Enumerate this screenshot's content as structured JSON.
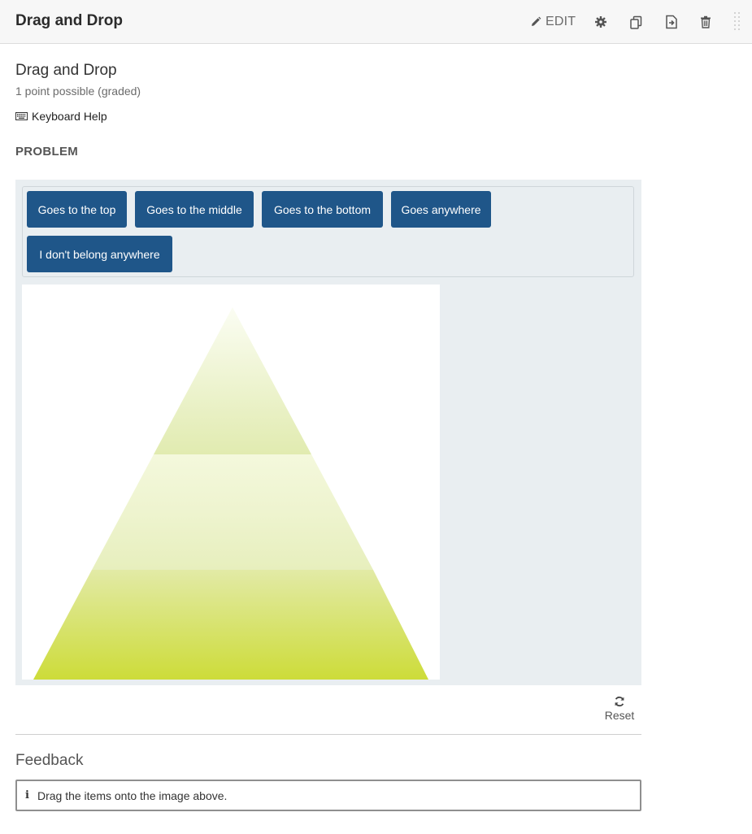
{
  "header": {
    "title": "Drag and Drop",
    "actions": {
      "edit_label": "EDIT",
      "edit_icon": "pencil-icon",
      "settings_icon": "gear-icon",
      "duplicate_icon": "duplicate-icon",
      "move_icon": "move-icon",
      "delete_icon": "trash-icon",
      "drag_icon": "drag-handle-icon"
    }
  },
  "problem": {
    "title": "Drag and Drop",
    "points": "1 point possible (graded)",
    "keyboard_help": "Keyboard Help",
    "keyboard_icon": "keyboard-icon",
    "section_heading": "PROBLEM"
  },
  "item_bank": {
    "items": [
      "Goes to the top",
      "Goes to the middle",
      "Goes to the bottom",
      "Goes anywhere",
      "I don't belong anywhere"
    ]
  },
  "target": {
    "pyramid_zones": [
      "top",
      "middle",
      "bottom"
    ]
  },
  "controls": {
    "reset_label": "Reset",
    "reset_icon": "refresh-icon"
  },
  "feedback": {
    "title": "Feedback",
    "message": "Drag the items onto the image above.",
    "icon": "info-icon"
  },
  "colors": {
    "item_bg": "#1f5689",
    "area_bg": "#e9eef1",
    "pyramid_base": "#cddc39"
  }
}
